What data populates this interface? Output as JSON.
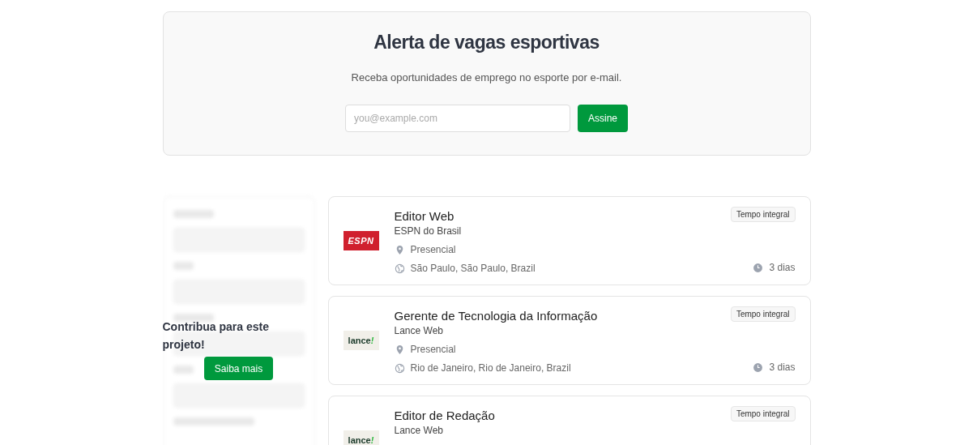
{
  "alert": {
    "title": "Alerta de vagas esportivas",
    "subtitle": "Receba oportunidades de emprego no esporte por e-mail.",
    "email_placeholder": "you@example.com",
    "button": "Assine"
  },
  "contribute": {
    "text": "Contribua para este projeto!",
    "button": "Saiba mais"
  },
  "jobs": [
    {
      "title": "Editor Web",
      "company": "ESPN do Brasil",
      "logo": {
        "kind": "espn",
        "text": "ESPN"
      },
      "type": "Tempo integral",
      "workplace": "Presencial",
      "location": "São Paulo, São Paulo, Brazil",
      "age": "3 dias"
    },
    {
      "title": "Gerente de Tecnologia da Informação",
      "company": "Lance Web",
      "logo": {
        "kind": "lance",
        "text": "lance!"
      },
      "type": "Tempo integral",
      "workplace": "Presencial",
      "location": "Rio de Janeiro, Rio de Janeiro, Brazil",
      "age": "3 dias"
    },
    {
      "title": "Editor de Redação",
      "company": "Lance Web",
      "logo": {
        "kind": "lance",
        "text": "lance!"
      },
      "type": "Tempo integral"
    }
  ]
}
